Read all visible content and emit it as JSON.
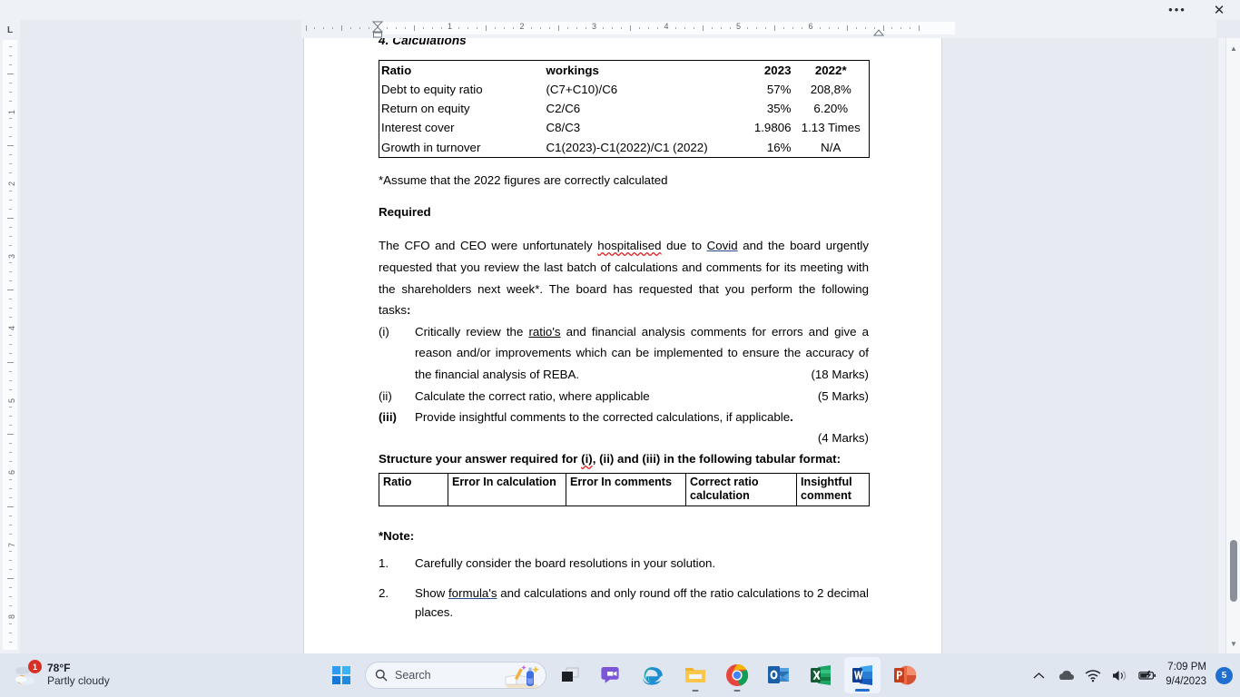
{
  "window": {
    "more_label": "•••",
    "close_label": "✕"
  },
  "ruler": {
    "horizontal_numbers": [
      "1",
      "2",
      "3",
      "4",
      "5",
      "6"
    ],
    "vertical_numbers": [
      "1",
      "2",
      "3",
      "4",
      "5",
      "6",
      "7",
      "8"
    ],
    "tab_stop_label": "L"
  },
  "document": {
    "section_heading": "4. Calculations",
    "ratio_table": {
      "headers": [
        "Ratio",
        "workings",
        "2023",
        "2022*"
      ],
      "rows": [
        {
          "ratio": "Debt to equity ratio",
          "workings": "(C7+C10)/C6",
          "y2023": "57%",
          "y2022": "208,8%"
        },
        {
          "ratio": "Return on equity",
          "workings": "C2/C6",
          "y2023": "35%",
          "y2022": "6.20%"
        },
        {
          "ratio": "Interest cover",
          "workings": "C8/C3",
          "y2023": "1.9806",
          "y2022": "1.13 Times"
        },
        {
          "ratio": "Growth in turnover",
          "workings": "C1(2023)-C1(2022)/C1 (2022)",
          "y2023": "16%",
          "y2022": "N/A"
        }
      ]
    },
    "assume_note": "*Assume that the  2022 figures are correctly calculated",
    "required_heading": "Required",
    "intro_paragraph": {
      "part1": "The CFO and CEO were unfortunately ",
      "misspelled": "hospitalised",
      "part2": " due to ",
      "linked": "Covid",
      "part3": " and the board urgently requested that you review the last batch of calculations and comments for its meeting with the shareholders next week*. The board has requested that you perform the following tasks",
      "part4": ":"
    },
    "tasks": [
      {
        "label": "(i)",
        "text_pre": "Critically review the ",
        "text_underlined": "ratio's",
        "text_post": " and financial analysis comments for errors and give a reason and/or improvements which can be implemented to ensure the accuracy of the financial analysis of REBA.",
        "marks": "(18 Marks)",
        "bold_label": false
      },
      {
        "label": "(ii)",
        "text_pre": "Calculate the correct ratio, where applicable",
        "text_underlined": "",
        "text_post": "",
        "marks": "(5 Marks)",
        "bold_label": false
      },
      {
        "label": "(iii)",
        "text_pre": "Provide insightful comments to the corrected calculations, if applicable",
        "text_underlined": "",
        "text_post": ".",
        "marks": "(4 Marks)",
        "bold_label": true
      }
    ],
    "structure_line": {
      "part1": "Structure your answer required for ",
      "misspelled": "(i)",
      "part2": ", (ii) and (iii) in the following tabular format:"
    },
    "format_table": {
      "headers": [
        "Ratio",
        "Error In calculation",
        "Error In comments",
        "Correct ratio calculation",
        "Insightful comment"
      ]
    },
    "note_heading": "*Note:",
    "notes": [
      {
        "label": "1.",
        "text_pre": "Carefully consider the board resolutions in your solution.",
        "text_underlined": "",
        "text_post": ""
      },
      {
        "label": "2.",
        "text_pre": "Show ",
        "text_underlined": "formula's",
        "text_post": " and calculations and only round off the ratio calculations to 2 decimal places."
      }
    ]
  },
  "scrollbar": {
    "up_arrow": "▲",
    "down_arrow": "▼"
  },
  "taskbar": {
    "weather": {
      "temperature": "78°F",
      "condition": "Partly cloudy",
      "badge_count": "1"
    },
    "search": {
      "placeholder": "Search"
    },
    "apps": [
      {
        "name": "start-button",
        "label": "Start"
      },
      {
        "name": "task-view-button",
        "label": "Task View"
      },
      {
        "name": "chat-button",
        "label": "Chat"
      },
      {
        "name": "edge-button",
        "label": "Microsoft Edge"
      },
      {
        "name": "file-explorer-button",
        "label": "File Explorer"
      },
      {
        "name": "chrome-button",
        "label": "Google Chrome"
      },
      {
        "name": "outlook-button",
        "label": "Outlook"
      },
      {
        "name": "excel-button",
        "label": "Excel"
      },
      {
        "name": "word-button",
        "label": "Word"
      },
      {
        "name": "powerpoint-button",
        "label": "PowerPoint"
      }
    ],
    "tray": {
      "time": "7:09 PM",
      "date": "9/4/2023",
      "notification_count": "5"
    }
  },
  "colors": {
    "accent": "#1f6fd0",
    "desktop_bg": "#e7ebf1",
    "taskbar_bg": "#dfe6f0",
    "spell_error": "#e02020",
    "badge_red": "#d93025"
  }
}
